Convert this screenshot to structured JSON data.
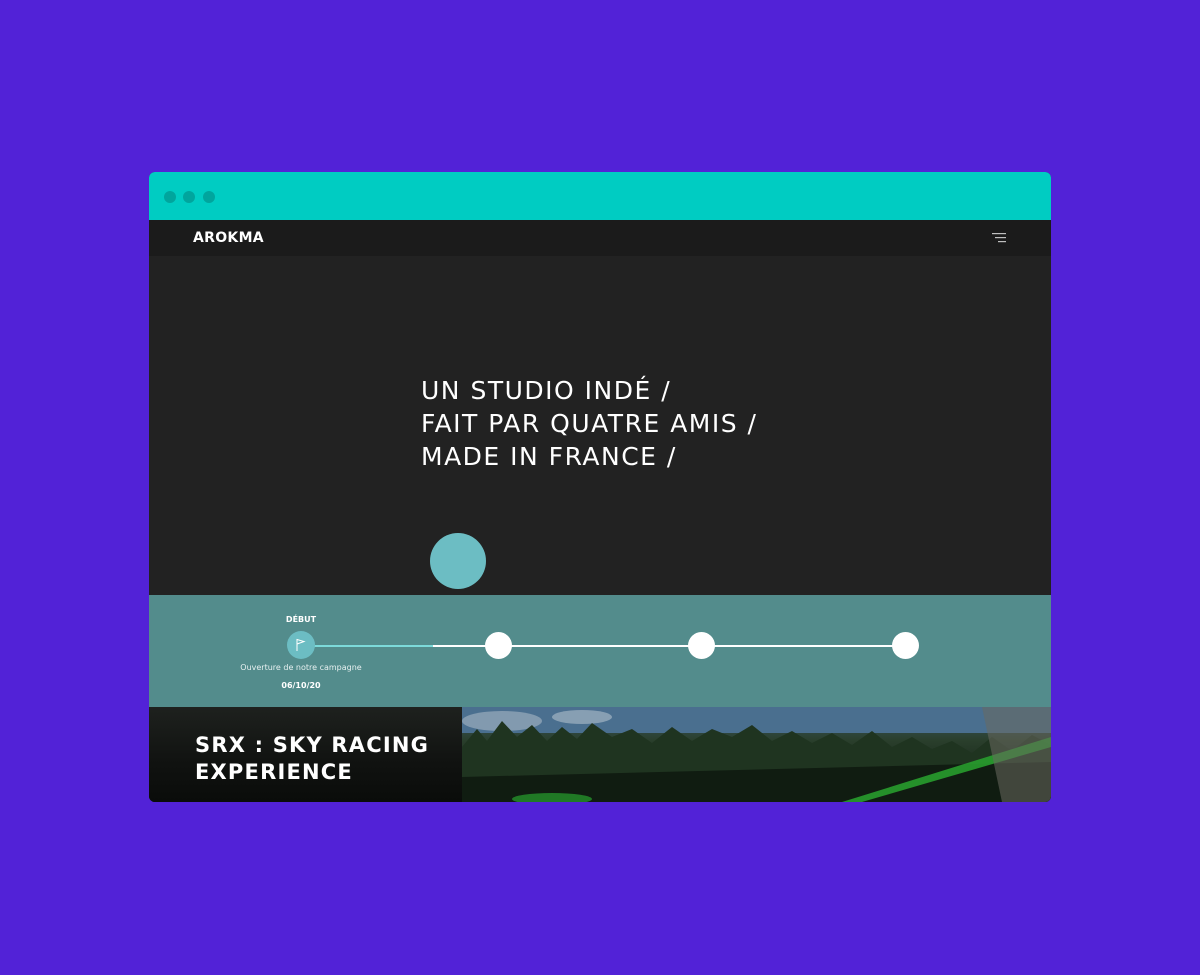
{
  "window": {
    "controls": [
      "window-dot",
      "window-dot",
      "window-dot"
    ]
  },
  "nav": {
    "logo": "AROKMA",
    "menu_icon": "menu-icon"
  },
  "hero": {
    "lines": [
      "UN STUDIO INDÉ /",
      "FAIT PAR QUATRE AMIS /",
      "MADE IN FRANCE /"
    ]
  },
  "timeline": {
    "start_title": "DÉBUT",
    "start_icon": "flag-icon",
    "start_description": "Ouverture de notre campagne",
    "start_date": "06/10/20",
    "milestone_count_visible": 4
  },
  "project": {
    "title_lines": [
      "SRX : SKY RACING",
      "EXPERIENCE"
    ]
  },
  "colors": {
    "background": "#5222d7",
    "chrome": "#00ccc2",
    "hero": "#222222",
    "timeline": "#538c8c",
    "accent": "#6cbdc3"
  }
}
